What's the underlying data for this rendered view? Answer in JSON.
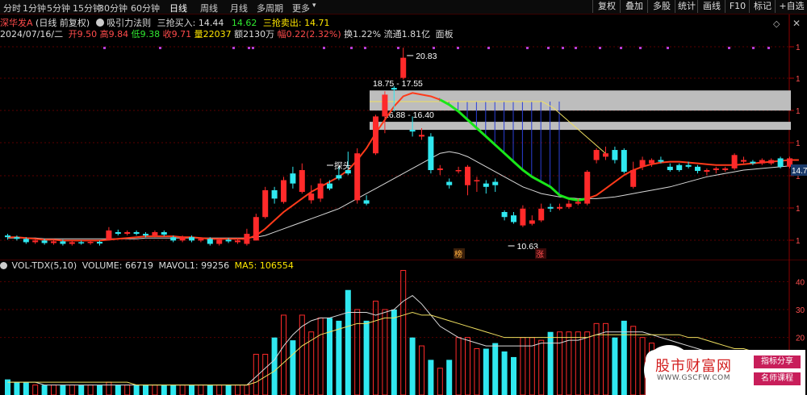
{
  "period_tabs": [
    "分时",
    "1分钟",
    "5分钟",
    "15分钟",
    "30分钟",
    "60分钟",
    "日线",
    "周线",
    "月线",
    "多周期",
    "更多"
  ],
  "period_more_arrow": "▾",
  "active_period": "日线",
  "right_buttons": [
    "复权",
    "叠加",
    "多股",
    "统计",
    "画线",
    "F10",
    "标记",
    "+自选"
  ],
  "header": {
    "stock_name": "深华发A",
    "adj": "(日线 前复权)",
    "indicator_icon": "gear-icon",
    "indicator": "吸引力法则",
    "buy_label": "三抢买入:",
    "buy_value": "14.44",
    "mid_value": "14.62",
    "sell_label": "三抢卖出:",
    "sell_value": "14.71"
  },
  "quote": {
    "date": "2024/07/16/二",
    "open_label": "开",
    "open": "9.50",
    "high_label": "高",
    "high": "9.84",
    "low_label": "低",
    "low": "9.38",
    "close_label": "收",
    "close": "9.71",
    "vol_label": "量",
    "vol": "22037",
    "amt_label": "额",
    "amt": "2130万",
    "chg_label": "幅",
    "chg": "0.22(2.32%)",
    "turnover_label": "换",
    "turnover": "1.22%",
    "float_label": "流通",
    "float": "1.81亿",
    "panel": "面板"
  },
  "annotations": {
    "high_mark": "20.83",
    "low_mark": "10.63",
    "zone_upper": "18.75 - 17.55",
    "zone_lower": "16.88 - 16.40",
    "probe": "探头",
    "price_tag": "14.7",
    "badge_bang": "榜",
    "badge_zhang": "涨"
  },
  "volume_header": {
    "name": "VOL-TDX(5,10)",
    "volume_label": "VOLUME:",
    "volume": "66719",
    "mavol1_label": "MAVOL1:",
    "mavol1": "99256",
    "ma5_label": "MA5:",
    "ma5": "106554"
  },
  "volume_axis": [
    "40",
    "30",
    "20"
  ],
  "watermark": {
    "title": "股市财富网",
    "url": "WWW.GSCFW.COM",
    "tag1": "指标分享",
    "tag2": "名师课程"
  },
  "colors": {
    "up": "#ff2a2a",
    "down": "#30e8f0",
    "ma_red": "#ff3a1a",
    "ma_green": "#19e619",
    "ma_white": "#d8d8d8",
    "ma_yellow": "#f0e060",
    "zone": "#bdbdbd",
    "vert": "#2b3fd6"
  },
  "chart_data": {
    "type": "candlestick",
    "price_range": [
      9.0,
      21.5
    ],
    "volume_range": [
      0,
      45
    ],
    "candles": [
      {
        "o": 10.1,
        "c": 10.0,
        "h": 10.2,
        "l": 9.85,
        "v": 5
      },
      {
        "o": 10.0,
        "c": 9.9,
        "h": 10.1,
        "l": 9.8,
        "v": 4
      },
      {
        "o": 9.9,
        "c": 9.7,
        "h": 10.0,
        "l": 9.6,
        "v": 4
      },
      {
        "o": 9.7,
        "c": 9.8,
        "h": 9.9,
        "l": 9.6,
        "v": 3
      },
      {
        "o": 9.8,
        "c": 9.65,
        "h": 9.9,
        "l": 9.55,
        "v": 3
      },
      {
        "o": 9.65,
        "c": 9.75,
        "h": 9.85,
        "l": 9.55,
        "v": 3
      },
      {
        "o": 9.75,
        "c": 9.6,
        "h": 9.85,
        "l": 9.5,
        "v": 3
      },
      {
        "o": 9.6,
        "c": 9.7,
        "h": 9.8,
        "l": 9.5,
        "v": 3
      },
      {
        "o": 9.7,
        "c": 9.65,
        "h": 9.8,
        "l": 9.55,
        "v": 3
      },
      {
        "o": 9.65,
        "c": 9.72,
        "h": 9.82,
        "l": 9.55,
        "v": 3
      },
      {
        "o": 9.72,
        "c": 9.62,
        "h": 9.8,
        "l": 9.5,
        "v": 3
      },
      {
        "o": 9.85,
        "c": 10.4,
        "h": 10.6,
        "l": 9.8,
        "v": 4
      },
      {
        "o": 10.3,
        "c": 10.2,
        "h": 10.45,
        "l": 10.1,
        "v": 3
      },
      {
        "o": 10.2,
        "c": 10.3,
        "h": 10.4,
        "l": 10.1,
        "v": 3
      },
      {
        "o": 10.3,
        "c": 10.2,
        "h": 10.4,
        "l": 10.1,
        "v": 3
      },
      {
        "o": 10.2,
        "c": 10.1,
        "h": 10.3,
        "l": 10.0,
        "v": 3
      },
      {
        "o": 10.1,
        "c": 10.3,
        "h": 10.4,
        "l": 10.0,
        "v": 3
      },
      {
        "o": 10.3,
        "c": 10.15,
        "h": 10.4,
        "l": 10.05,
        "v": 3
      },
      {
        "o": 10.0,
        "c": 9.8,
        "h": 10.1,
        "l": 9.7,
        "v": 3
      },
      {
        "o": 9.8,
        "c": 10.0,
        "h": 10.1,
        "l": 9.7,
        "v": 3
      },
      {
        "o": 10.0,
        "c": 9.8,
        "h": 10.1,
        "l": 9.7,
        "v": 3
      },
      {
        "o": 9.8,
        "c": 9.9,
        "h": 10.0,
        "l": 9.7,
        "v": 3
      },
      {
        "o": 9.9,
        "c": 9.6,
        "h": 10.0,
        "l": 9.5,
        "v": 3
      },
      {
        "o": 9.6,
        "c": 9.85,
        "h": 9.95,
        "l": 9.5,
        "v": 3
      },
      {
        "o": 9.85,
        "c": 9.75,
        "h": 9.95,
        "l": 9.65,
        "v": 3
      },
      {
        "o": 9.7,
        "c": 9.8,
        "h": 9.95,
        "l": 9.6,
        "v": 3
      },
      {
        "o": 9.6,
        "c": 10.2,
        "h": 10.5,
        "l": 9.5,
        "v": 3
      },
      {
        "o": 9.8,
        "c": 11.2,
        "h": 11.4,
        "l": 9.8,
        "v": 14
      },
      {
        "o": 11.2,
        "c": 12.8,
        "h": 13.0,
        "l": 11.1,
        "v": 14
      },
      {
        "o": 12.8,
        "c": 12.3,
        "h": 13.0,
        "l": 12.0,
        "v": 20
      },
      {
        "o": 12.1,
        "c": 13.4,
        "h": 13.6,
        "l": 12.0,
        "v": 28
      },
      {
        "o": 13.8,
        "c": 13.2,
        "h": 14.2,
        "l": 12.9,
        "v": 19
      },
      {
        "o": 12.7,
        "c": 14.0,
        "h": 14.4,
        "l": 12.6,
        "v": 28
      },
      {
        "o": 12.2,
        "c": 12.6,
        "h": 13.1,
        "l": 12.0,
        "v": 22
      },
      {
        "o": 12.3,
        "c": 13.2,
        "h": 13.5,
        "l": 12.1,
        "v": 27
      },
      {
        "o": 13.2,
        "c": 12.9,
        "h": 13.4,
        "l": 12.8,
        "v": 27
      },
      {
        "o": 13.7,
        "c": 13.5,
        "h": 14.2,
        "l": 13.4,
        "v": 26
      },
      {
        "o": 14.0,
        "c": 13.8,
        "h": 15.1,
        "l": 13.7,
        "v": 37
      },
      {
        "o": 12.2,
        "c": 15.0,
        "h": 15.3,
        "l": 12.0,
        "v": 30
      },
      {
        "o": 12.2,
        "c": 12.0,
        "h": 12.5,
        "l": 11.9,
        "v": 26
      },
      {
        "o": 15.0,
        "c": 17.2,
        "h": 17.3,
        "l": 14.9,
        "v": 33
      },
      {
        "o": 17.2,
        "c": 18.5,
        "h": 18.7,
        "l": 16.2,
        "v": 30
      },
      {
        "o": 18.9,
        "c": 18.8,
        "h": 19.0,
        "l": 17.5,
        "v": 30
      },
      {
        "o": 19.5,
        "c": 20.7,
        "h": 21.3,
        "l": 19.4,
        "v": 44
      },
      {
        "o": 16.4,
        "c": 16.3,
        "h": 17.2,
        "l": 16.0,
        "v": 20
      },
      {
        "o": 16.0,
        "c": 16.1,
        "h": 16.5,
        "l": 15.8,
        "v": 17
      },
      {
        "o": 16.0,
        "c": 14.0,
        "h": 16.2,
        "l": 13.8,
        "v": 12
      },
      {
        "o": 14.0,
        "c": 14.1,
        "h": 14.3,
        "l": 13.7,
        "v": 9
      },
      {
        "o": 13.3,
        "c": 13.1,
        "h": 13.5,
        "l": 12.9,
        "v": 12
      },
      {
        "o": 14.0,
        "c": 14.0,
        "h": 14.2,
        "l": 13.8,
        "v": 20
      },
      {
        "o": 13.1,
        "c": 14.2,
        "h": 14.3,
        "l": 12.5,
        "v": 20
      },
      {
        "o": 13.4,
        "c": 13.4,
        "h": 13.6,
        "l": 12.7,
        "v": 16
      },
      {
        "o": 13.2,
        "c": 13.0,
        "h": 13.4,
        "l": 12.6,
        "v": 16
      },
      {
        "o": 13.3,
        "c": 13.1,
        "h": 13.5,
        "l": 12.7,
        "v": 18
      },
      {
        "o": 11.5,
        "c": 11.2,
        "h": 11.6,
        "l": 11.0,
        "v": 15
      },
      {
        "o": 11.3,
        "c": 10.9,
        "h": 11.5,
        "l": 10.8,
        "v": 13
      },
      {
        "o": 10.7,
        "c": 11.7,
        "h": 11.9,
        "l": 10.6,
        "v": 20
      },
      {
        "o": 10.8,
        "c": 11.0,
        "h": 11.3,
        "l": 10.7,
        "v": 20
      },
      {
        "o": 11.0,
        "c": 11.7,
        "h": 12.0,
        "l": 10.9,
        "v": 19
      },
      {
        "o": 11.8,
        "c": 11.7,
        "h": 12.0,
        "l": 11.5,
        "v": 22
      },
      {
        "o": 11.7,
        "c": 11.8,
        "h": 12.0,
        "l": 11.6,
        "v": 22
      },
      {
        "o": 11.8,
        "c": 12.0,
        "h": 12.2,
        "l": 11.7,
        "v": 22
      },
      {
        "o": 12.0,
        "c": 12.1,
        "h": 12.3,
        "l": 11.9,
        "v": 22
      },
      {
        "o": 12.0,
        "c": 13.9,
        "h": 14.0,
        "l": 11.9,
        "v": 22
      },
      {
        "o": 14.6,
        "c": 15.2,
        "h": 15.3,
        "l": 14.4,
        "v": 25
      },
      {
        "o": 14.8,
        "c": 15.0,
        "h": 15.4,
        "l": 14.6,
        "v": 25
      },
      {
        "o": 15.2,
        "c": 14.6,
        "h": 15.4,
        "l": 14.4,
        "v": 20
      },
      {
        "o": 15.2,
        "c": 13.9,
        "h": 15.3,
        "l": 13.8,
        "v": 26
      },
      {
        "o": 13.0,
        "c": 14.0,
        "h": 14.5,
        "l": 12.9,
        "v": 24
      },
      {
        "o": 14.2,
        "c": 14.6,
        "h": 14.8,
        "l": 14.0,
        "v": 20
      },
      {
        "o": 14.4,
        "c": 14.6,
        "h": 14.7,
        "l": 14.2,
        "v": 18
      },
      {
        "o": 14.6,
        "c": 14.5,
        "h": 14.8,
        "l": 14.4,
        "v": 16
      },
      {
        "o": 14.2,
        "c": 14.0,
        "h": 14.4,
        "l": 13.9,
        "v": 15
      },
      {
        "o": 14.3,
        "c": 14.0,
        "h": 14.4,
        "l": 13.9,
        "v": 13
      },
      {
        "o": 14.3,
        "c": 14.2,
        "h": 14.5,
        "l": 14.1,
        "v": 14
      },
      {
        "o": 14.2,
        "c": 13.95,
        "h": 14.3,
        "l": 13.8,
        "v": 12
      },
      {
        "o": 13.9,
        "c": 14.0,
        "h": 14.1,
        "l": 13.7,
        "v": 12
      },
      {
        "o": 14.0,
        "c": 14.1,
        "h": 14.2,
        "l": 13.8,
        "v": 12
      },
      {
        "o": 14.0,
        "c": 14.1,
        "h": 14.2,
        "l": 13.9,
        "v": 12
      },
      {
        "o": 14.1,
        "c": 14.9,
        "h": 15.0,
        "l": 14.0,
        "v": 13
      },
      {
        "o": 14.5,
        "c": 14.6,
        "h": 14.8,
        "l": 14.4,
        "v": 13
      },
      {
        "o": 14.5,
        "c": 14.4,
        "h": 14.6,
        "l": 14.3,
        "v": 13
      },
      {
        "o": 14.4,
        "c": 14.6,
        "h": 14.7,
        "l": 14.3,
        "v": 13
      },
      {
        "o": 14.4,
        "c": 14.6,
        "h": 14.7,
        "l": 14.3,
        "v": 13
      },
      {
        "o": 14.7,
        "c": 14.2,
        "h": 14.8,
        "l": 14.1,
        "v": 13
      },
      {
        "o": 14.2,
        "c": 14.7,
        "h": 14.8,
        "l": 14.1,
        "v": 13
      }
    ],
    "ma_fast": [
      10.0,
      10.0,
      9.95,
      9.9,
      9.85,
      9.85,
      9.8,
      9.8,
      9.8,
      9.8,
      9.8,
      9.85,
      9.9,
      9.95,
      10.0,
      10.05,
      10.05,
      10.05,
      10.05,
      10.0,
      10.0,
      9.95,
      9.9,
      9.9,
      9.9,
      9.9,
      9.9,
      10.1,
      10.5,
      11.0,
      11.5,
      11.9,
      12.3,
      12.7,
      13.0,
      13.3,
      13.6,
      14.0,
      14.6,
      15.3,
      16.2,
      17.0,
      17.8,
      18.4,
      18.6,
      18.5,
      18.4,
      18.2,
      17.9,
      17.5,
      17.0,
      16.5,
      16.0,
      15.5,
      15.0,
      14.5,
      14.0,
      13.6,
      13.3,
      13.0,
      12.5,
      12.3,
      12.2,
      12.3,
      12.5,
      12.9,
      13.3,
      13.7,
      14.0,
      14.2,
      14.35,
      14.45,
      14.5,
      14.5,
      14.45,
      14.4,
      14.35,
      14.3,
      14.3,
      14.3,
      14.35,
      14.4,
      14.45,
      14.5,
      14.55,
      14.6,
      14.6
    ],
    "ma_green_range": [
      47,
      63
    ],
    "ma_slow": [
      9.95,
      9.95,
      9.95,
      9.95,
      9.9,
      9.9,
      9.9,
      9.9,
      9.9,
      9.9,
      9.9,
      9.9,
      9.9,
      9.9,
      9.9,
      9.95,
      9.95,
      9.95,
      9.95,
      9.95,
      9.95,
      9.95,
      9.95,
      9.95,
      9.95,
      9.95,
      9.95,
      10.0,
      10.1,
      10.3,
      10.5,
      10.7,
      10.9,
      11.1,
      11.3,
      11.5,
      11.7,
      12.0,
      12.3,
      12.6,
      12.9,
      13.2,
      13.5,
      13.8,
      14.1,
      14.4,
      14.7,
      15.0,
      15.1,
      15.0,
      14.8,
      14.5,
      14.2,
      13.9,
      13.6,
      13.3,
      13.0,
      12.8,
      12.6,
      12.5,
      12.4,
      12.35,
      12.3,
      12.3,
      12.3,
      12.35,
      12.4,
      12.5,
      12.6,
      12.7,
      12.8,
      12.9,
      13.0,
      13.15,
      13.3,
      13.45,
      13.6,
      13.7,
      13.8,
      13.9,
      14.0,
      14.05,
      14.1,
      14.15,
      14.2,
      14.25,
      14.3
    ],
    "zones": [
      {
        "label_key": "zone_upper",
        "top": 18.75,
        "bottom": 17.55
      },
      {
        "label_key": "zone_lower",
        "top": 16.88,
        "bottom": 16.4
      }
    ],
    "vol_ma_white": [
      4,
      4,
      4,
      4,
      3,
      3,
      3,
      3,
      3,
      3,
      3,
      3,
      3,
      3,
      3,
      3,
      3,
      3,
      3,
      3,
      3,
      3,
      3,
      3,
      3,
      3,
      3,
      6,
      9,
      12,
      17,
      21,
      24,
      26,
      27,
      27,
      28,
      29,
      29,
      29,
      28,
      29,
      30,
      33,
      35,
      32,
      28,
      24,
      22,
      20,
      19,
      18,
      17,
      17,
      17,
      17,
      17,
      17,
      18,
      18,
      18,
      19,
      19,
      20,
      21,
      22,
      22,
      22,
      22,
      22,
      21,
      20,
      19,
      18,
      17,
      16,
      15,
      14,
      14,
      13,
      13,
      13,
      13,
      13,
      13,
      13,
      13
    ],
    "vol_ma_yellow": [
      4,
      4,
      4,
      4,
      4,
      4,
      4,
      4,
      4,
      4,
      4,
      4,
      4,
      4,
      3,
      3,
      3,
      3,
      3,
      3,
      3,
      3,
      3,
      3,
      3,
      3,
      3,
      4,
      6,
      8,
      11,
      14,
      17,
      19,
      21,
      22,
      23,
      24,
      25,
      25,
      26,
      27,
      27,
      28,
      29,
      28,
      28,
      27,
      26,
      25,
      24,
      23,
      22,
      21,
      20,
      20,
      20,
      20,
      20,
      20,
      20,
      20,
      20,
      20,
      21,
      21,
      21,
      21,
      21,
      21,
      21,
      21,
      21,
      21,
      20,
      20,
      19,
      18,
      17,
      16,
      16,
      15,
      15,
      14,
      14,
      13,
      13
    ]
  }
}
